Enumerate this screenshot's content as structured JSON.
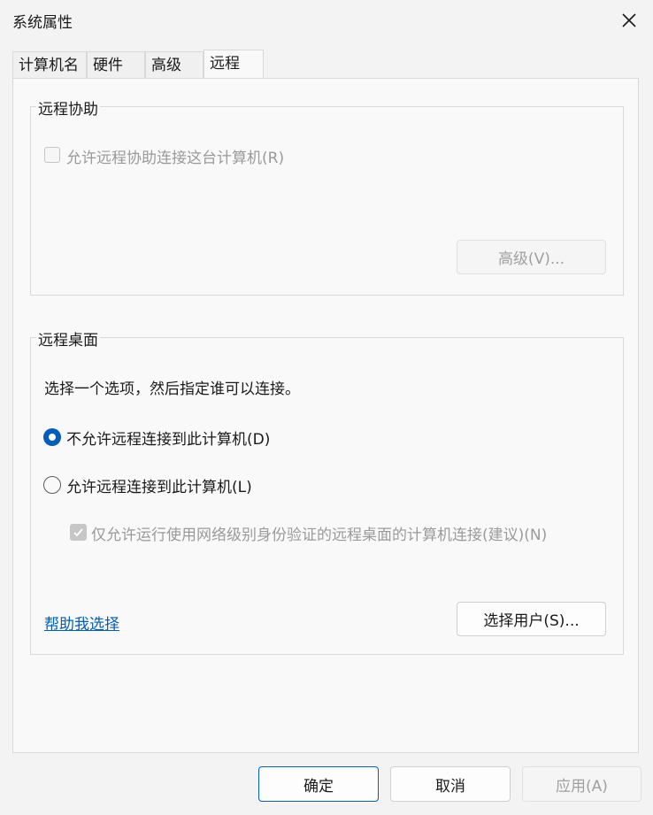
{
  "window": {
    "title": "系统属性"
  },
  "tabs": [
    {
      "label": "计算机名",
      "active": false
    },
    {
      "label": "硬件",
      "active": false
    },
    {
      "label": "高级",
      "active": false
    },
    {
      "label": "远程",
      "active": true
    }
  ],
  "remote_assistance": {
    "group_title": "远程协助",
    "allow_checkbox": {
      "label": "允许远程协助连接这台计算机(R)",
      "checked": false,
      "enabled": false
    },
    "advanced_button": {
      "label": "高级(V)...",
      "enabled": false
    }
  },
  "remote_desktop": {
    "group_title": "远程桌面",
    "instruction": "选择一个选项，然后指定谁可以连接。",
    "options": [
      {
        "label": "不允许远程连接到此计算机(D)",
        "selected": true
      },
      {
        "label": "允许远程连接到此计算机(L)",
        "selected": false
      }
    ],
    "nla_checkbox": {
      "label": "仅允许运行使用网络级别身份验证的远程桌面的计算机连接(建议)(N)",
      "checked": true,
      "enabled": false
    },
    "help_link": "帮助我选择",
    "select_users_button": "选择用户(S)..."
  },
  "footer": {
    "ok": "确定",
    "cancel": "取消",
    "apply": {
      "label": "应用(A)",
      "enabled": false
    }
  },
  "colors": {
    "accent": "#005fb8",
    "background": "#f3f3f3",
    "panel": "#f9f9f9"
  },
  "icons": {
    "close": "close-icon",
    "check": "checkmark-icon"
  }
}
